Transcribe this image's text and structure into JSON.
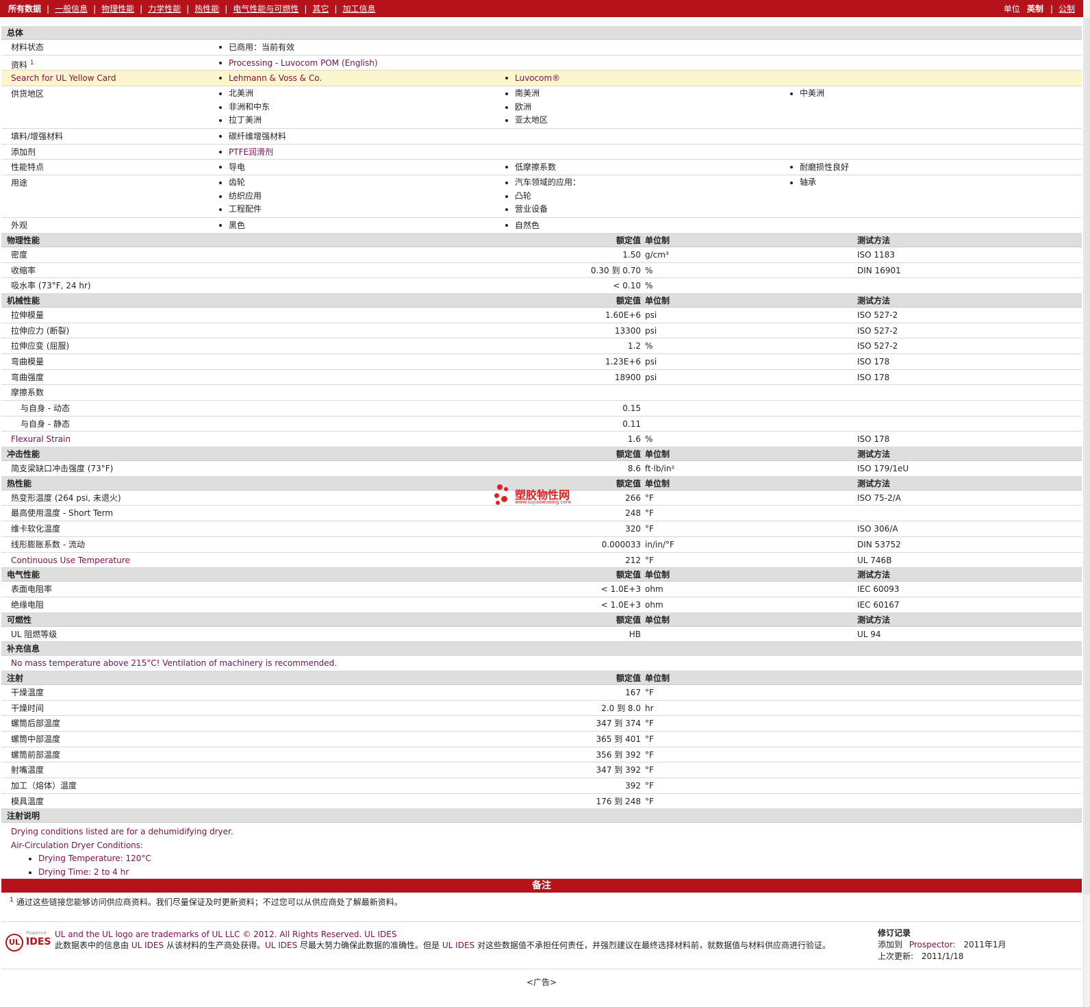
{
  "nav": {
    "items": [
      "所有数据",
      "一般信息",
      "物理性能",
      "力学性能",
      "热性能",
      "电气性能与可燃性",
      "其它",
      "加工信息"
    ],
    "units_label": "单位",
    "unit_english": "英制",
    "unit_metric": "公制"
  },
  "headers": {
    "value": "额定值",
    "unit": "单位制",
    "method": "测试方法"
  },
  "general": {
    "title": "总体",
    "status_label": "材料状态",
    "status_value": "已商用：当前有效",
    "docs_label": "资料",
    "docs_sup": "1",
    "docs_value": "Processing - Luvocom POM (English)",
    "ul_label": "Search for UL Yellow Card",
    "ul_v1": "Lehmann & Voss & Co.",
    "ul_v2": "Luvocom®",
    "region_label": "供货地区",
    "region_col1": [
      "北美洲",
      "非洲和中东",
      "拉丁美洲"
    ],
    "region_col2": [
      "南美洲",
      "欧洲",
      "亚太地区"
    ],
    "region_col3": [
      "中美洲"
    ],
    "filler_label": "填料/增强材料",
    "filler_value": "碳纤维增强材料",
    "additive_label": "添加剂",
    "additive_value": "PTFE润滑剂",
    "feature_label": "性能特点",
    "feature_v1": "导电",
    "feature_v2": "低摩擦系数",
    "feature_v3": "耐磨损性良好",
    "use_label": "用途",
    "use_col1": [
      "齿轮",
      "纺织应用",
      "工程配件"
    ],
    "use_col2": [
      "汽车领域的应用：",
      "凸轮",
      "营业设备"
    ],
    "use_col3": [
      "轴承"
    ],
    "appearance_label": "外观",
    "appearance_v1": "黑色",
    "appearance_v2": "自然色"
  },
  "physical": {
    "title": "物理性能",
    "rows": [
      {
        "name": "密度",
        "value": "1.50",
        "unit": "g/cm³",
        "method": "ISO 1183"
      },
      {
        "name": "收缩率",
        "value": "0.30 到  0.70",
        "unit": "%",
        "method": "DIN 16901"
      },
      {
        "name": "吸水率  (73°F, 24 hr)",
        "value": "< 0.10",
        "unit": "%",
        "method": ""
      }
    ]
  },
  "mechanical": {
    "title": "机械性能",
    "rows": [
      {
        "name": "拉伸模量",
        "value": "1.60E+6",
        "unit": "psi",
        "method": "ISO 527-2"
      },
      {
        "name": "拉伸应力  (断裂)",
        "value": "13300",
        "unit": "psi",
        "method": "ISO 527-2"
      },
      {
        "name": "拉伸应变  (屈服)",
        "value": "1.2",
        "unit": "%",
        "method": "ISO 527-2"
      },
      {
        "name": "弯曲模量",
        "value": "1.23E+6",
        "unit": "psi",
        "method": "ISO 178"
      },
      {
        "name": "弯曲强度",
        "value": "18900",
        "unit": "psi",
        "method": "ISO 178"
      },
      {
        "name": "摩擦系数",
        "value": "",
        "unit": "",
        "method": ""
      },
      {
        "name": "与自身   - 动态",
        "value": "0.15",
        "unit": "",
        "method": "",
        "sub": true
      },
      {
        "name": "与自身   - 静态",
        "value": "0.11",
        "unit": "",
        "method": "",
        "sub": true
      },
      {
        "name": "Flexural Strain",
        "value": "1.6",
        "unit": "%",
        "method": "ISO 178",
        "link": true
      }
    ]
  },
  "impact": {
    "title": "冲击性能",
    "rows": [
      {
        "name": "简支梁缺口冲击强度  (73°F)",
        "value": "8.6",
        "unit": "ft·lb/in²",
        "method": "ISO 179/1eU"
      }
    ]
  },
  "thermal": {
    "title": "热性能",
    "rows": [
      {
        "name": "热变形温度  (264 psi, 未退火)",
        "value": "266",
        "unit": "°F",
        "method": "ISO 75-2/A"
      },
      {
        "name": "最高使用温度   - Short Term",
        "value": "248",
        "unit": "°F",
        "method": ""
      },
      {
        "name": "维卡软化温度",
        "value": "320",
        "unit": "°F",
        "method": "ISO 306/A"
      },
      {
        "name": "线形膨胀系数   - 流动",
        "value": "0.000033",
        "unit": "in/in/°F",
        "method": "DIN 53752"
      },
      {
        "name": "Continuous Use Temperature",
        "value": "212",
        "unit": "°F",
        "method": "UL 746B",
        "link": true
      }
    ]
  },
  "electrical": {
    "title": "电气性能",
    "rows": [
      {
        "name": "表面电阻率",
        "value": "< 1.0E+3",
        "unit": "ohm",
        "method": "IEC 60093"
      },
      {
        "name": "绝缘电阻",
        "value": "< 1.0E+3",
        "unit": "ohm",
        "method": "IEC 60167"
      }
    ]
  },
  "flammability": {
    "title": "可燃性",
    "rows": [
      {
        "name": "UL 阻燃等级",
        "value": "HB",
        "unit": "",
        "method": "UL 94"
      }
    ]
  },
  "supplement": {
    "title": "补充信息",
    "text": "No mass temperature above 215°C! Ventilation of machinery is recommended."
  },
  "injection": {
    "title": "注射",
    "rows": [
      {
        "name": "干燥温度",
        "value": "167",
        "unit": "°F"
      },
      {
        "name": "干燥时间",
        "value": "2.0 到  8.0",
        "unit": "hr"
      },
      {
        "name": "螺筒后部温度",
        "value": "347 到  374",
        "unit": "°F"
      },
      {
        "name": "螺筒中部温度",
        "value": "365 到  401",
        "unit": "°F"
      },
      {
        "name": "螺筒前部温度",
        "value": "356 到  392",
        "unit": "°F"
      },
      {
        "name": "射嘴温度",
        "value": "347 到  392",
        "unit": "°F"
      },
      {
        "name": "加工（熔体）温度",
        "value": "392",
        "unit": "°F"
      },
      {
        "name": "模具温度",
        "value": "176 到  248",
        "unit": "°F"
      }
    ]
  },
  "injection_notes": {
    "title": "注射说明",
    "line1": "Drying conditions listed are for a dehumidifying dryer.",
    "line2": "Air-Circulation Dryer Conditions:",
    "bullet1": "Drying Temperature: 120°C",
    "bullet2": "Drying Time: 2 to 4 hr"
  },
  "remarks": {
    "title": "备注",
    "footnote_sup": "1",
    "footnote": "通过这些链接您能够访问供应商资料。我们尽量保证及时更新资料；不过您可以从供应商处了解最新资料。"
  },
  "footer": {
    "logo_powered": "Powered by",
    "logo_ul": "UL",
    "logo_ides": "IDES",
    "trademark": "UL and the UL logo are trademarks of UL LLC © 2012. All Rights Reserved. UL IDES",
    "legal_a": "此数据表中的信息由",
    "legal_link1": "UL IDES",
    "legal_b": "从该材料的生产商处获得。",
    "legal_link2": "UL IDES",
    "legal_c": "尽最大努力确保此数据的准确性。但是",
    "legal_link3": "UL IDES",
    "legal_d": "对这些数据值不承担任何责任，并强烈建议在最终选择材料前，就数据值与材料供应商进行验证。",
    "rev_title": "修订记录",
    "added_label": "添加到",
    "added_link": "Prospector:",
    "added_value": "2011年1月",
    "updated_label": "上次更新:",
    "updated_value": "2011/1/18",
    "ad": "<广告>"
  },
  "watermark": {
    "text": "塑胶物性网",
    "url": "www.sujiaowuxing.com"
  }
}
